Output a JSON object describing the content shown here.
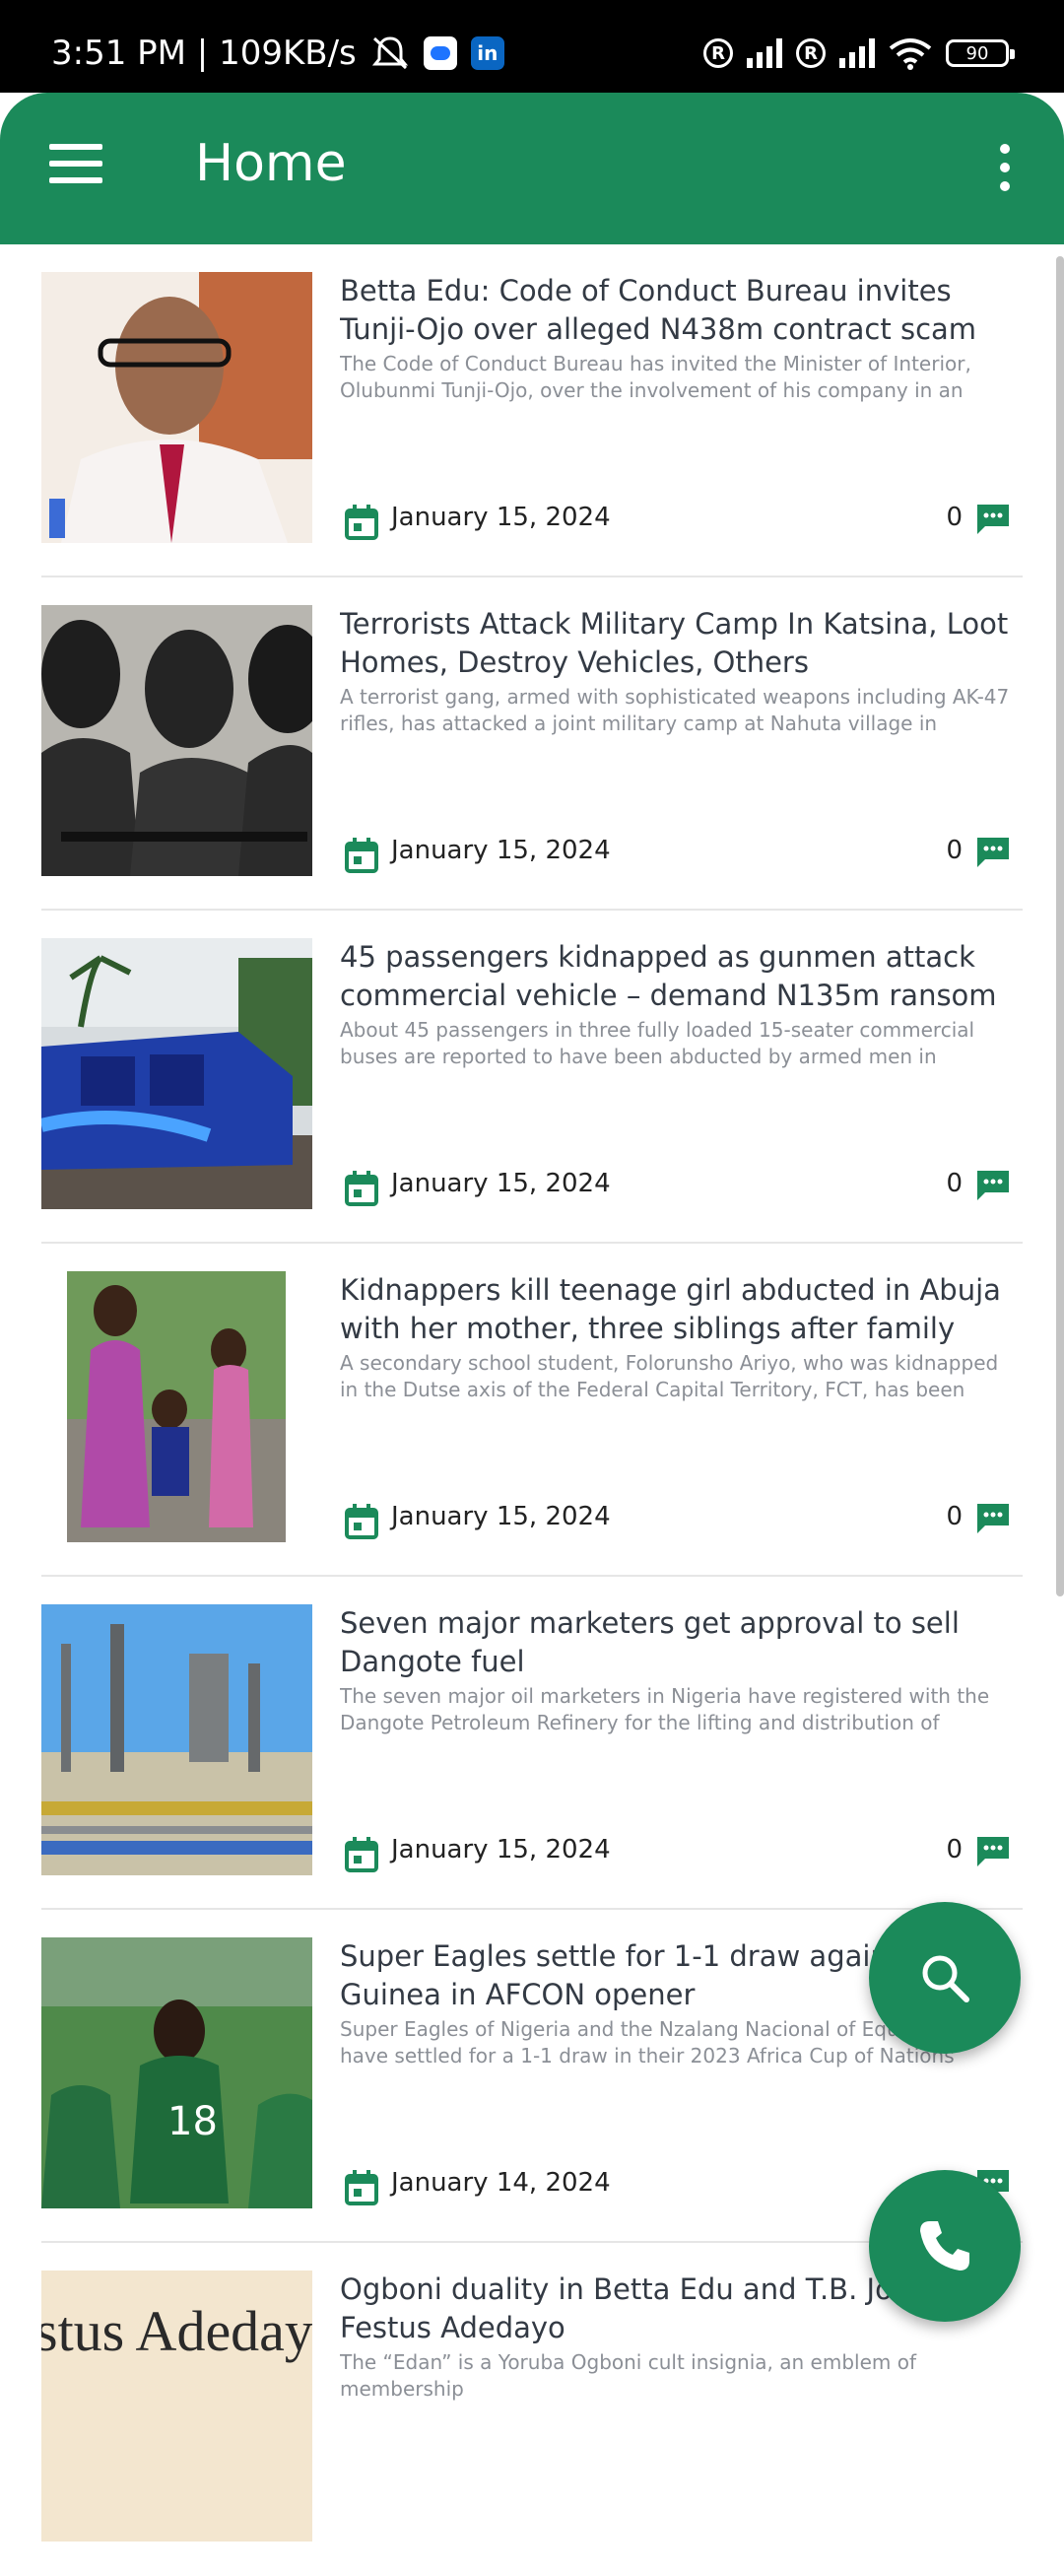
{
  "status_bar": {
    "time": "3:51 PM | 109KB/s",
    "battery": "90"
  },
  "app_bar": {
    "title": "Home"
  },
  "colors": {
    "primary": "#1b8a5a",
    "title_text": "#333a44",
    "excerpt_text": "#8b8f96"
  },
  "articles": [
    {
      "title": "Betta Edu: Code of Conduct Bureau invites Tunji-Ojo over alleged N438m contract scam",
      "excerpt": "The Code of Conduct Bureau has invited the Minister of Interior, Olubunmi Tunji-Ojo, over the involvement of his company in an alleged",
      "date": "January 15, 2024",
      "comments": "0"
    },
    {
      "title": "Terrorists Attack Military Camp In Katsina, Loot Homes, Destroy Vehicles, Others",
      "excerpt": "A terrorist gang, armed with sophisticated weapons including AK-47 rifles, has attacked a joint military camp at Nahuta village in Batsari",
      "date": "January 15, 2024",
      "comments": "0"
    },
    {
      "title": "45 passengers kidnapped as gunmen attack commercial vehicle – demand N135m ransom",
      "excerpt": "About 45 passengers in three fully loaded 15-seater commercial buses are reported to have been abducted by armed men in Orokam, along the",
      "date": "January 15, 2024",
      "comments": "0"
    },
    {
      "title": "Kidnappers kill teenage girl abducted in Abuja with her mother, three siblings after family failed to",
      "excerpt": "A secondary school student, Folorunsho Ariyo, who was kidnapped in the Dutse axis of the Federal Capital Territory, FCT, has been killed by",
      "date": "January 15, 2024",
      "comments": "0"
    },
    {
      "title": "Seven major marketers get approval to sell Dangote fuel",
      "excerpt": "The seven major oil marketers in Nigeria have registered with the Dangote Petroleum Refinery for the lifting and distribution of refined",
      "date": "January 15, 2024",
      "comments": "0"
    },
    {
      "title": "Super Eagles settle for 1-1 draw against Guinea in AFCON opener",
      "excerpt": "Super Eagles of Nigeria and the Nzalang Nacional of Equatorial have settled for a 1-1 draw in their 2023 Africa Cup of Nations (AFCON)",
      "date": "January 14, 2024",
      "comments": ""
    },
    {
      "title": "Ogboni duality in Betta Edu and T.B. Joshua Festus Adedayo",
      "excerpt": "The “Edan” is a Yoruba Ogboni cult insignia, an emblem of membership",
      "date": "",
      "comments": "",
      "thumb_text": "stus Adedayo's"
    }
  ]
}
